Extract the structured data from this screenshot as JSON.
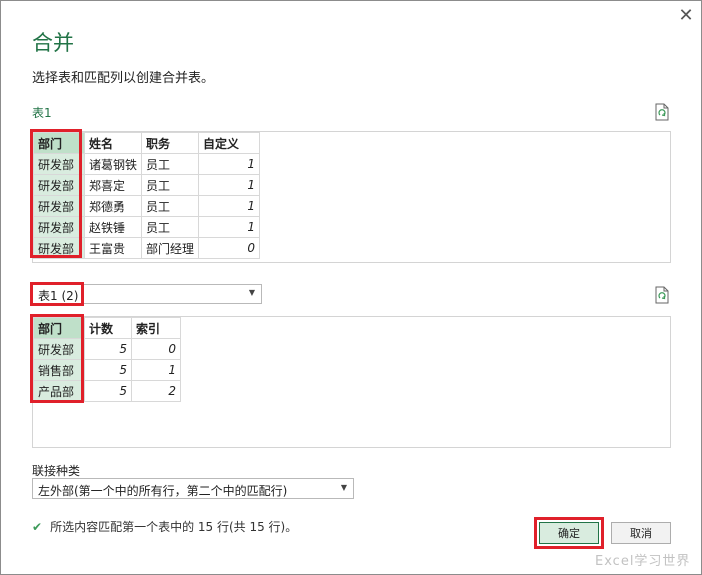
{
  "dialog": {
    "title": "合并",
    "subtitle": "选择表和匹配列以创建合并表。",
    "close_glyph": "✕"
  },
  "table1": {
    "label": "表1",
    "columns": [
      "部门",
      "姓名",
      "职务",
      "自定义"
    ],
    "rows": [
      [
        "研发部",
        "诸葛钢铁",
        "员工",
        "1"
      ],
      [
        "研发部",
        "郑喜定",
        "员工",
        "1"
      ],
      [
        "研发部",
        "郑德勇",
        "员工",
        "1"
      ],
      [
        "研发部",
        "赵铁锤",
        "员工",
        "1"
      ],
      [
        "研发部",
        "王富贵",
        "部门经理",
        "0"
      ]
    ]
  },
  "table2": {
    "selected_table": "表1 (2)",
    "columns": [
      "部门",
      "计数",
      "索引"
    ],
    "rows": [
      [
        "研发部",
        "5",
        "0"
      ],
      [
        "销售部",
        "5",
        "1"
      ],
      [
        "产品部",
        "5",
        "2"
      ]
    ]
  },
  "join": {
    "label": "联接种类",
    "selected": "左外部(第一个中的所有行，第二个中的匹配行)"
  },
  "status": {
    "text": "所选内容匹配第一个表中的 15 行(共 15 行)。"
  },
  "buttons": {
    "ok": "确定",
    "cancel": "取消"
  },
  "watermark": "Excel学习世界",
  "icons": {
    "refresh": "refresh-icon",
    "check": "check-icon",
    "close": "close-icon",
    "dropdown": "chevron-down-icon"
  },
  "colors": {
    "accent": "#217346",
    "highlight": "#d9ecdf",
    "annotation": "#e0202a"
  }
}
